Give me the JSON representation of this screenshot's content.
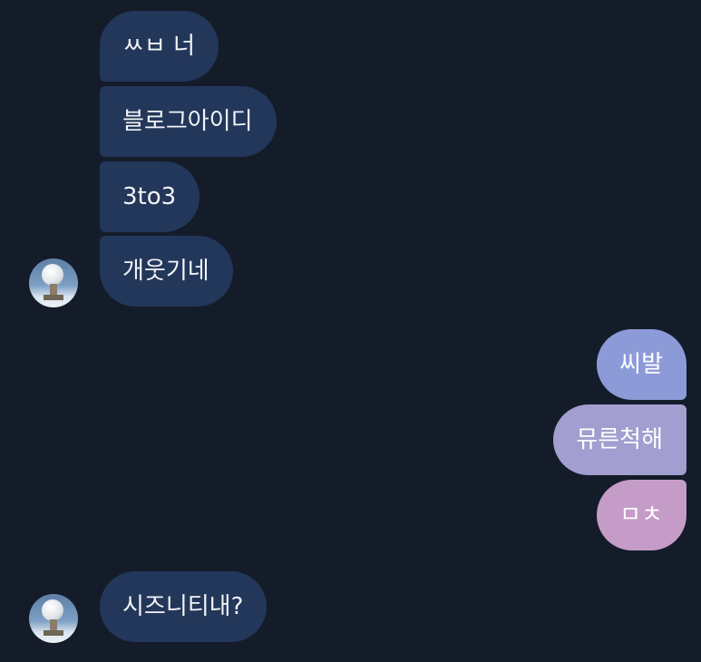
{
  "conversation": {
    "incoming_group_1": [
      {
        "text": "ㅆㅂ 너"
      },
      {
        "text": "블로그아이디"
      },
      {
        "text": "3to3"
      },
      {
        "text": "개웃기네"
      }
    ],
    "outgoing_group": [
      {
        "text": "씨발"
      },
      {
        "text": "뮤른척해"
      },
      {
        "text": "ㅁㅊ"
      }
    ],
    "incoming_group_2": [
      {
        "text": "시즈니티내?"
      }
    ]
  },
  "colors": {
    "background": "#141c2a",
    "incoming_bubble": "#23375a",
    "outgoing_gradient": [
      "#8c9bd8",
      "#a29ecf",
      "#c49cc7"
    ]
  },
  "avatar": {
    "icon": "radar-dome-avatar-icon"
  }
}
